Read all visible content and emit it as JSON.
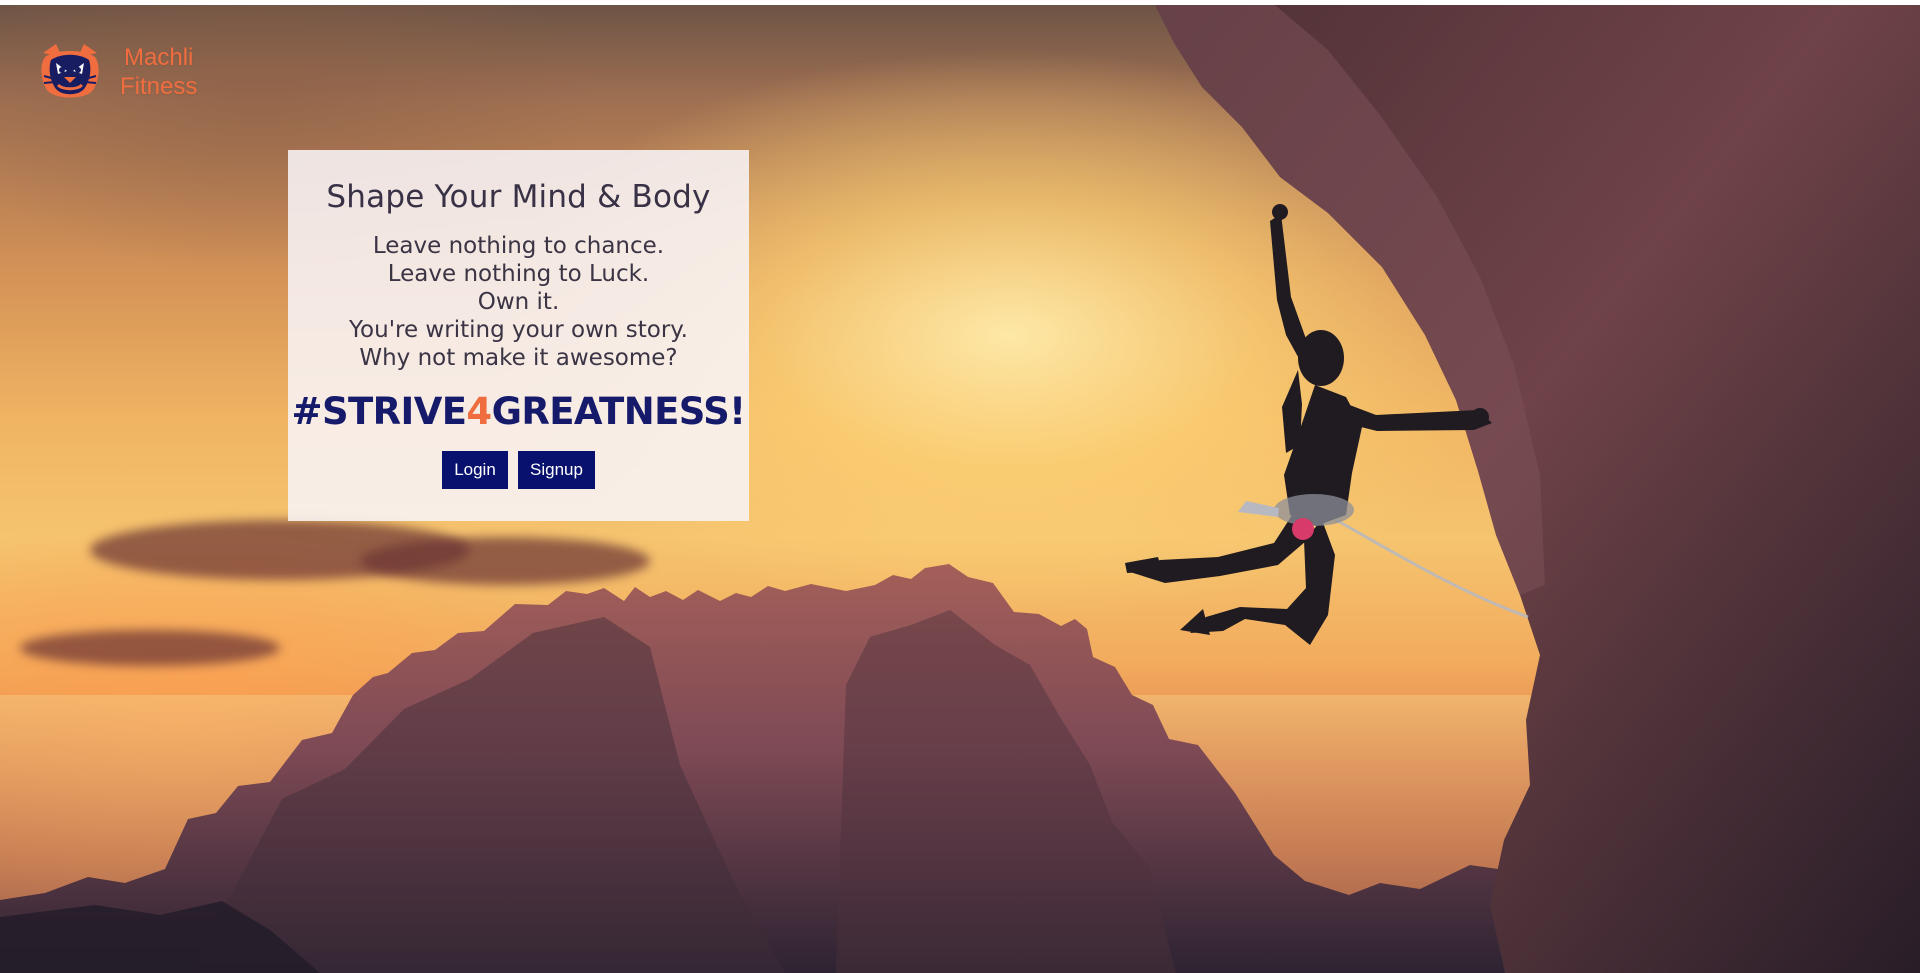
{
  "brand": {
    "logo_icon": "tiger-face-icon",
    "name_line_1": "Machli",
    "name_line_2": "Fitness",
    "accent_color": "#f06d3f"
  },
  "hero": {
    "title": "Shape Your Mind & Body",
    "motto_lines": [
      "Leave nothing to chance.",
      "Leave nothing to Luck.",
      "Own it.",
      "You're writing your own story.",
      "Why not make it awesome?"
    ],
    "tagline": {
      "prefix": "#STRIVE",
      "highlight": "4",
      "suffix": "GREATNESS!"
    }
  },
  "actions": {
    "login_label": "Login",
    "signup_label": "Signup",
    "button_color": "#08116d"
  },
  "background": {
    "image_subject": "rock-climber-on-cliff-at-sunset"
  }
}
